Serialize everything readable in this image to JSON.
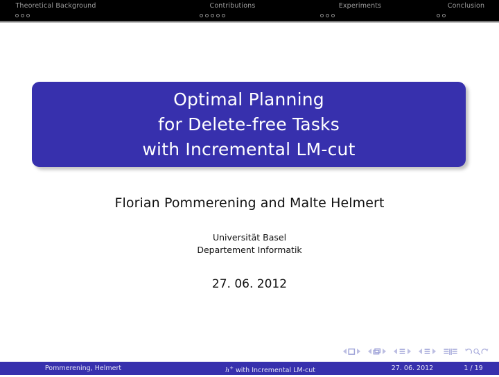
{
  "header": {
    "sections": [
      {
        "title": "Theoretical Background",
        "dots": 3
      },
      {
        "title": "Contributions",
        "dots": 5
      },
      {
        "title": "Experiments",
        "dots": 3
      },
      {
        "title": "Conclusion",
        "dots": 2
      }
    ]
  },
  "title_block": {
    "line1": "Optimal Planning",
    "line2": "for Delete-free Tasks",
    "line3": "with Incremental LM-cut",
    "background_color": "#3730ad",
    "text_color": "#ffffff"
  },
  "authors": "Florian Pommerening and Malte Helmert",
  "institute": {
    "line1": "Universität Basel",
    "line2": "Departement Informatik"
  },
  "date": "27. 06. 2012",
  "nav_symbols": [
    "first-slide-icon",
    "previous-slide-icon",
    "slide-icon",
    "next-slide-icon",
    "last-slide-icon",
    "first-frame-icon",
    "previous-frame-icon",
    "frame-icon",
    "next-frame-icon",
    "last-frame-icon",
    "first-subsection-icon",
    "previous-subsection-icon",
    "subsection-icon",
    "next-subsection-icon",
    "first-section-icon",
    "previous-section-icon",
    "section-icon",
    "next-section-icon",
    "beginning-of-presentation-icon",
    "end-of-presentation-icon",
    "back-icon",
    "search-icon",
    "forward-icon"
  ],
  "footer": {
    "author": "Pommerening, Helmert",
    "title_prefix": "h",
    "title_sup": "+",
    "title_rest": " with Incremental LM-cut",
    "date": "27. 06. 2012",
    "page": "1 / 19",
    "background_color": "#3730ad",
    "text_color": "#e6e6f5"
  }
}
